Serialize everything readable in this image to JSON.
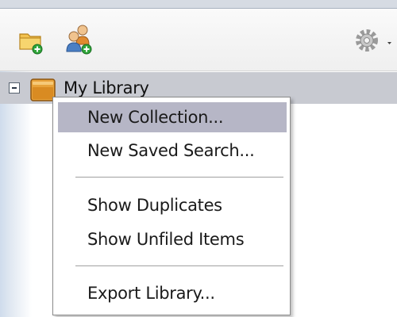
{
  "toolbar": {
    "icons": {
      "new_collection": "folder-add-icon",
      "new_group": "group-add-icon",
      "actions": "gear-icon",
      "actions_dropdown": "chevron-down-icon"
    }
  },
  "tree": {
    "library_label": "My Library",
    "library_icon": "library-icon",
    "toggle_icon": "collapse-icon"
  },
  "context_menu": {
    "items": [
      {
        "label": "New Collection...",
        "highlighted": true
      },
      {
        "label": "New Saved Search..."
      },
      {
        "label": "Show Duplicates"
      },
      {
        "label": "Show Unfiled Items"
      },
      {
        "label": "Export Library..."
      }
    ]
  },
  "colors": {
    "selected_row": "#c8cad1",
    "menu_highlight": "#b6b6c6",
    "folder_orange": "#e8a23a",
    "add_badge_green": "#2fa53a"
  }
}
